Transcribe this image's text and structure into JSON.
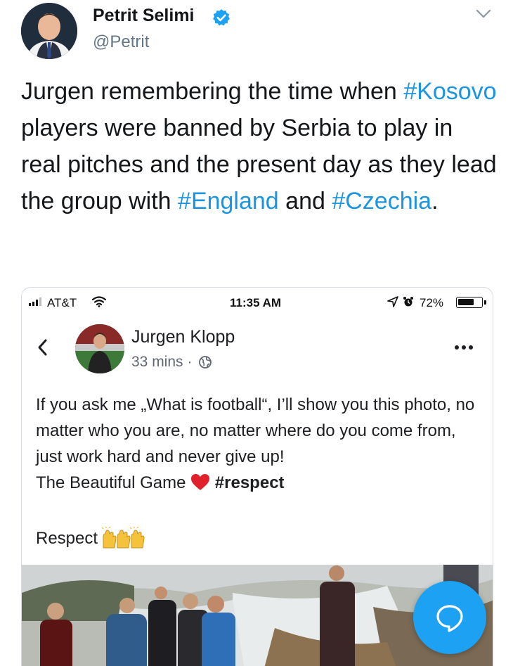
{
  "tweet": {
    "author_name": "Petrit Selimi",
    "handle": "@Petrit",
    "text_parts": [
      {
        "t": "Jurgen remembering the time when ",
        "tag": false
      },
      {
        "t": "#Kosovo",
        "tag": true
      },
      {
        "t": " players were banned by Serbia to play in real pitches and the present day as they lead the group with ",
        "tag": false
      },
      {
        "t": "#England",
        "tag": true
      },
      {
        "t": " and ",
        "tag": false
      },
      {
        "t": "#Czechia",
        "tag": true
      },
      {
        "t": ".",
        "tag": false
      }
    ]
  },
  "status_bar": {
    "carrier": "AT&T",
    "time": "11:35 AM",
    "battery": "72%",
    "battery_level": 0.72
  },
  "fb_post": {
    "author": "Jurgen Klopp",
    "time": "33 mins",
    "separator": "·",
    "body": "If you ask me „What is football“, I’ll show you this photo, no matter who you are, no matter where do you come from, just work hard and never give up!",
    "line2_prefix": "The Beautiful Game",
    "hashtag": "#respect",
    "respect": "Respect"
  },
  "icons": {
    "verified": "verified-badge-icon",
    "chevron": "chevron-down-icon",
    "back": "back-arrow-icon",
    "globe": "globe-icon",
    "more": "more-options-icon",
    "heart": "red-heart-icon",
    "hands": "raised-hands-icon",
    "compose": "reply-bubble-icon"
  },
  "colors": {
    "hashtag": "#1b95e0",
    "verified": "#1da1f2",
    "fab": "#1da1f2",
    "heart": "#e0202b"
  }
}
